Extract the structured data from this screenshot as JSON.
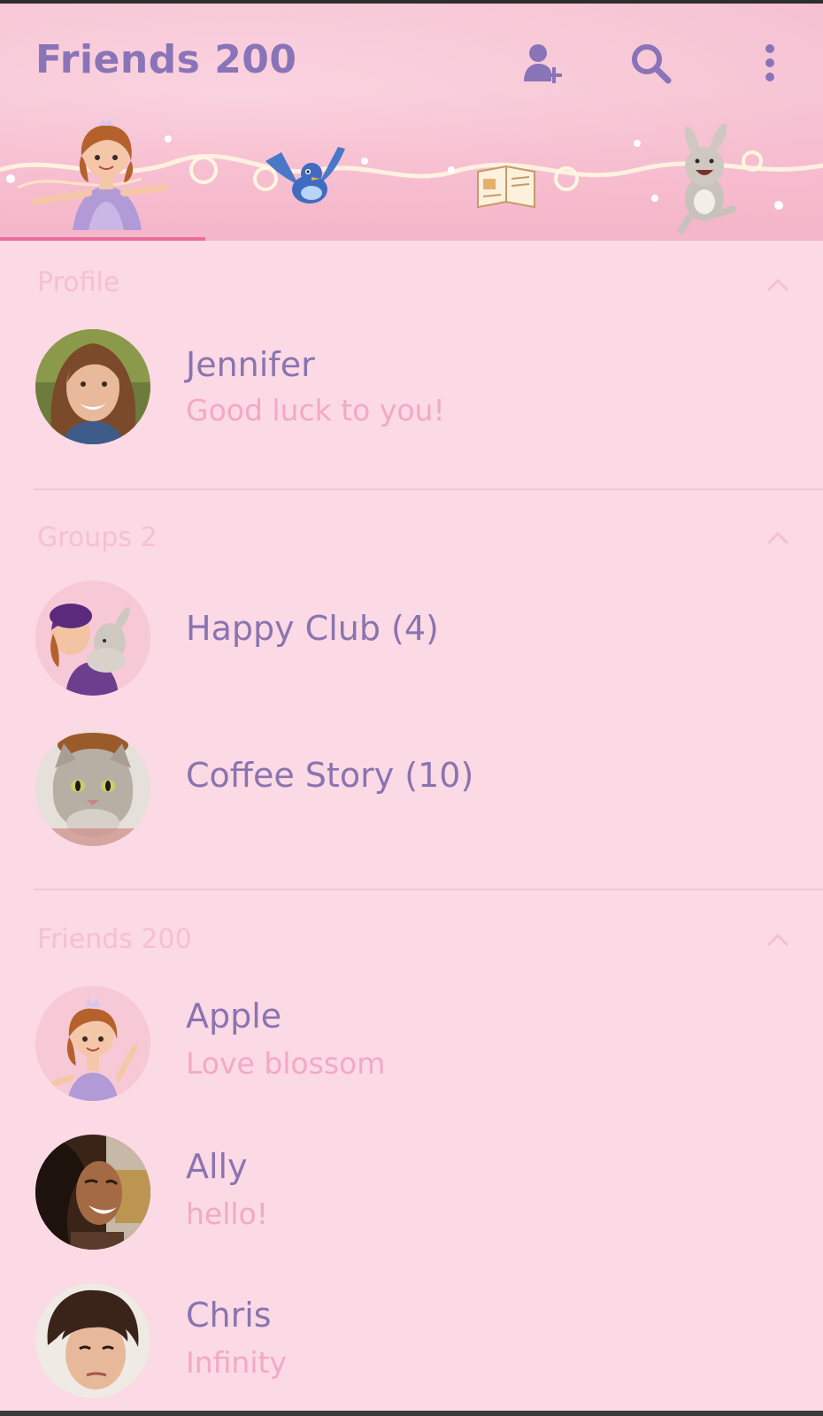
{
  "header": {
    "title": "Friends 200",
    "icons": [
      "add-friend-icon",
      "search-icon",
      "more-vertical-icon"
    ],
    "accent_color": "#ec6c9a"
  },
  "sections": {
    "profile": {
      "title": "Profile",
      "items": [
        {
          "name": "Jennifer",
          "status": "Good luck to you!"
        }
      ]
    },
    "groups": {
      "title": "Groups 2",
      "items": [
        {
          "name": "Happy Club (4)"
        },
        {
          "name": "Coffee Story (10)"
        }
      ]
    },
    "friends": {
      "title": "Friends 200",
      "items": [
        {
          "name": "Apple",
          "status": "Love blossom"
        },
        {
          "name": "Ally",
          "status": "hello!"
        },
        {
          "name": "Chris",
          "status": "Infinity"
        }
      ]
    }
  },
  "colors": {
    "background": "#fbd9e5",
    "name_text": "#8a74b0",
    "status_text": "#f2a9c4",
    "section_text": "#f6c0d2"
  }
}
